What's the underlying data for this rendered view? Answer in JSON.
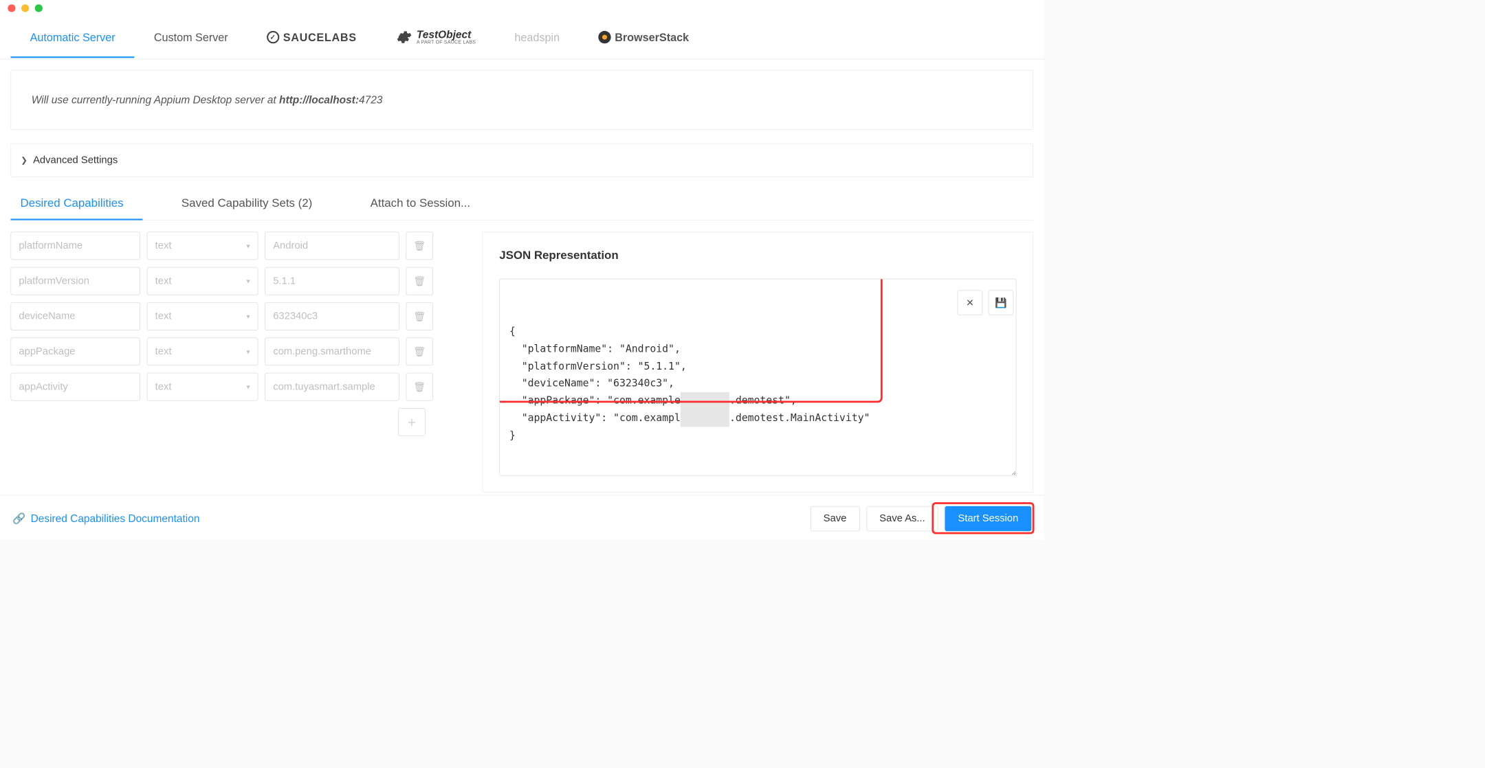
{
  "serverTabs": {
    "automatic": "Automatic Server",
    "custom": "Custom Server",
    "saucelabs": "SAUCELABS",
    "testobject": {
      "name": "TestObject",
      "tagline": "A PART OF SAUCE LABS"
    },
    "headspin": "headspin",
    "browserstack": "BrowserStack"
  },
  "info": {
    "prefix": "Will use currently-running Appium Desktop server at ",
    "host": "http://localhost:",
    "port": "4723"
  },
  "advancedSettings": "Advanced Settings",
  "capTabs": {
    "desired": "Desired Capabilities",
    "saved": "Saved Capability Sets (2)",
    "attach": "Attach to Session..."
  },
  "capabilities": [
    {
      "name": "platformName",
      "type": "text",
      "value": "Android"
    },
    {
      "name": "platformVersion",
      "type": "text",
      "value": "5.1.1"
    },
    {
      "name": "deviceName",
      "type": "text",
      "value": "632340c3"
    },
    {
      "name": "appPackage",
      "type": "text",
      "value": "com.peng.smarthome"
    },
    {
      "name": "appActivity",
      "type": "text",
      "value": "com.tuyasmart.sample"
    }
  ],
  "jsonPanel": {
    "title": "JSON Representation",
    "lines": {
      "open": "{",
      "l1a": "  \"platformName\": \"Android\",",
      "l2a": "  \"platformVersion\": \"5.1.1\",",
      "l3a": "  \"deviceName\": \"632340c3\",",
      "l4a": "  \"appPackage\": \"com.example",
      "l4b": ".demotest\",",
      "l5a": "  \"appActivity\": \"com.exampl",
      "l5b": ".demotest.MainActivity\"",
      "close": "}"
    }
  },
  "footer": {
    "docLink": "Desired Capabilities Documentation",
    "save": "Save",
    "saveAs": "Save As...",
    "start": "Start Session"
  }
}
